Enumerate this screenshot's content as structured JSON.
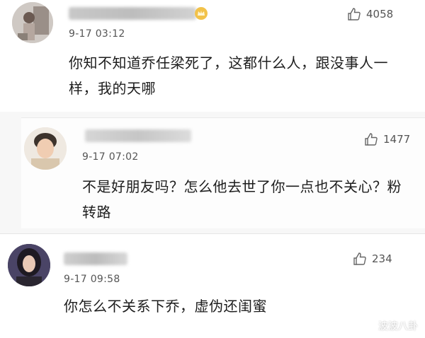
{
  "comments": [
    {
      "time": "9-17 03:12",
      "likes": "4058",
      "text_lines": [
        "你知不知道乔任梁死了，这都什么人，跟没事人一",
        "样，我的天哪"
      ]
    },
    {
      "time": "9-17 07:02",
      "likes": "1477",
      "text_lines": [
        "不是好朋友吗？怎么他去世了你一点也不关心？粉",
        "转路"
      ]
    },
    {
      "time": "9-17 09:58",
      "likes": "234",
      "text_lines": [
        "你怎么不关系下乔，虚伪还闺蜜"
      ]
    }
  ],
  "icons": {
    "like": "thumbs-up-icon",
    "badge": "crown-badge-icon",
    "watermark": "watermark-logo-icon"
  },
  "watermark": "波波八卦"
}
